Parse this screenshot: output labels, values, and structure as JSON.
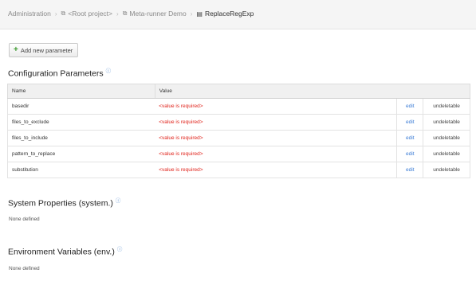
{
  "breadcrumb": {
    "items": [
      "Administration",
      "<Root project>",
      "Meta-runner Demo"
    ],
    "current": "ReplaceRegExp"
  },
  "toolbar": {
    "add_label": "Add new parameter"
  },
  "config": {
    "title": "Configuration Parameters",
    "headers": {
      "name": "Name",
      "value": "Value"
    },
    "rows": [
      {
        "name": "basedir",
        "value": "<value is required>",
        "edit": "edit",
        "status": "undeletable"
      },
      {
        "name": "files_to_exclude",
        "value": "<value is required>",
        "edit": "edit",
        "status": "undeletable"
      },
      {
        "name": "files_to_include",
        "value": "<value is required>",
        "edit": "edit",
        "status": "undeletable"
      },
      {
        "name": "pattern_to_replace",
        "value": "<value is required>",
        "edit": "edit",
        "status": "undeletable"
      },
      {
        "name": "substitution",
        "value": "<value is required>",
        "edit": "edit",
        "status": "undeletable"
      }
    ]
  },
  "system": {
    "title": "System Properties (system.)",
    "empty": "None defined"
  },
  "env": {
    "title": "Environment Variables (env.)",
    "empty": "None defined"
  },
  "colors": {
    "required": "#e0231b",
    "link": "#3a7bd5",
    "add": "#3c9a2e"
  }
}
